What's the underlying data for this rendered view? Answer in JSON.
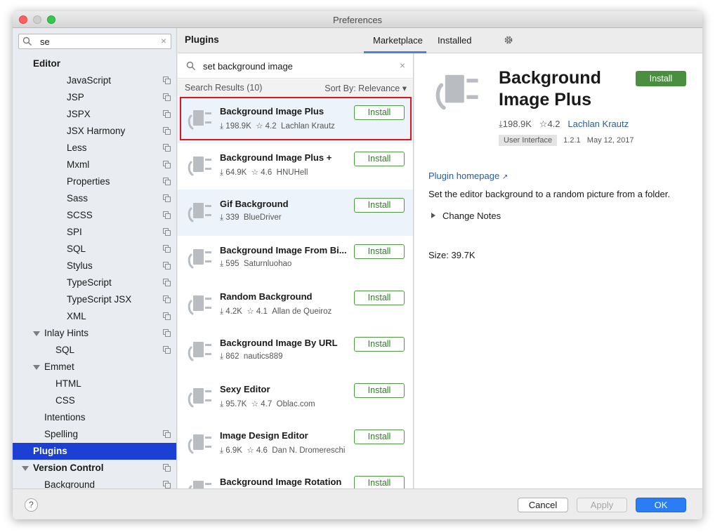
{
  "window": {
    "title": "Preferences"
  },
  "sidebar": {
    "search": {
      "value": "se"
    },
    "items": [
      {
        "label": "Editor",
        "indent": 0,
        "bold": true,
        "expand": "none",
        "copy": false,
        "selected": false
      },
      {
        "label": "JavaScript",
        "indent": 3,
        "bold": false,
        "expand": "none",
        "copy": true,
        "selected": false
      },
      {
        "label": "JSP",
        "indent": 3,
        "bold": false,
        "expand": "none",
        "copy": true,
        "selected": false
      },
      {
        "label": "JSPX",
        "indent": 3,
        "bold": false,
        "expand": "none",
        "copy": true,
        "selected": false
      },
      {
        "label": "JSX Harmony",
        "indent": 3,
        "bold": false,
        "expand": "none",
        "copy": true,
        "selected": false
      },
      {
        "label": "Less",
        "indent": 3,
        "bold": false,
        "expand": "none",
        "copy": true,
        "selected": false
      },
      {
        "label": "Mxml",
        "indent": 3,
        "bold": false,
        "expand": "none",
        "copy": true,
        "selected": false
      },
      {
        "label": "Properties",
        "indent": 3,
        "bold": false,
        "expand": "none",
        "copy": true,
        "selected": false
      },
      {
        "label": "Sass",
        "indent": 3,
        "bold": false,
        "expand": "none",
        "copy": true,
        "selected": false
      },
      {
        "label": "SCSS",
        "indent": 3,
        "bold": false,
        "expand": "none",
        "copy": true,
        "selected": false
      },
      {
        "label": "SPI",
        "indent": 3,
        "bold": false,
        "expand": "none",
        "copy": true,
        "selected": false
      },
      {
        "label": "SQL",
        "indent": 3,
        "bold": false,
        "expand": "none",
        "copy": true,
        "selected": false
      },
      {
        "label": "Stylus",
        "indent": 3,
        "bold": false,
        "expand": "none",
        "copy": true,
        "selected": false
      },
      {
        "label": "TypeScript",
        "indent": 3,
        "bold": false,
        "expand": "none",
        "copy": true,
        "selected": false
      },
      {
        "label": "TypeScript JSX",
        "indent": 3,
        "bold": false,
        "expand": "none",
        "copy": true,
        "selected": false
      },
      {
        "label": "XML",
        "indent": 3,
        "bold": false,
        "expand": "none",
        "copy": true,
        "selected": false
      },
      {
        "label": "Inlay Hints",
        "indent": 1,
        "bold": false,
        "expand": "open",
        "copy": true,
        "selected": false
      },
      {
        "label": "SQL",
        "indent": 2,
        "bold": false,
        "expand": "none",
        "copy": true,
        "selected": false
      },
      {
        "label": "Emmet",
        "indent": 1,
        "bold": false,
        "expand": "open",
        "copy": false,
        "selected": false
      },
      {
        "label": "HTML",
        "indent": 2,
        "bold": false,
        "expand": "none",
        "copy": false,
        "selected": false
      },
      {
        "label": "CSS",
        "indent": 2,
        "bold": false,
        "expand": "none",
        "copy": false,
        "selected": false
      },
      {
        "label": "Intentions",
        "indent": 1,
        "bold": false,
        "expand": "none",
        "copy": false,
        "selected": false
      },
      {
        "label": "Spelling",
        "indent": 1,
        "bold": false,
        "expand": "none",
        "copy": true,
        "selected": false
      },
      {
        "label": "Plugins",
        "indent": 0,
        "bold": true,
        "expand": "none",
        "copy": false,
        "selected": true
      },
      {
        "label": "Version Control",
        "indent": 0,
        "bold": true,
        "expand": "open",
        "copy": true,
        "selected": false
      },
      {
        "label": "Background",
        "indent": 1,
        "bold": false,
        "expand": "none",
        "copy": true,
        "selected": false
      }
    ]
  },
  "plugins_header": {
    "title": "Plugins",
    "tabs": [
      {
        "label": "Marketplace",
        "active": true
      },
      {
        "label": "Installed",
        "active": false
      }
    ],
    "settings_icon": "gear-icon"
  },
  "list": {
    "search": {
      "value": "set background image"
    },
    "results_label": "Search Results (10)",
    "sort_label": "Sort By: Relevance",
    "install_label": "Install",
    "plugins": [
      {
        "name": "Background Image Plus",
        "downloads": "198.9K",
        "rating": "4.2",
        "author": "Lachlan Krautz",
        "highlighted": true,
        "alt": true
      },
      {
        "name": "Background Image Plus +",
        "downloads": "64.9K",
        "rating": "4.6",
        "author": "HNUHell",
        "highlighted": false,
        "alt": false
      },
      {
        "name": "Gif Background",
        "downloads": "339",
        "rating": "",
        "author": "BlueDriver",
        "highlighted": false,
        "alt": true
      },
      {
        "name": "Background Image From Bi...",
        "downloads": "595",
        "rating": "",
        "author": "Saturnluohao",
        "highlighted": false,
        "alt": false
      },
      {
        "name": "Random Background",
        "downloads": "4.2K",
        "rating": "4.1",
        "author": "Allan de Queiroz",
        "highlighted": false,
        "alt": false
      },
      {
        "name": "Background Image By URL",
        "downloads": "862",
        "rating": "",
        "author": "nautics889",
        "highlighted": false,
        "alt": false
      },
      {
        "name": "Sexy Editor",
        "downloads": "95.7K",
        "rating": "4.7",
        "author": "Oblac.com",
        "highlighted": false,
        "alt": false
      },
      {
        "name": "Image Design Editor",
        "downloads": "6.9K",
        "rating": "4.6",
        "author": "Dan N. Dromereschi",
        "highlighted": false,
        "alt": false
      },
      {
        "name": "Background Image Rotation",
        "downloads": "",
        "rating": "",
        "author": "",
        "highlighted": false,
        "alt": false
      }
    ]
  },
  "detail": {
    "title": "Background Image Plus",
    "install_label": "Install",
    "downloads": "198.9K",
    "rating": "4.2",
    "author": "Lachlan Krautz",
    "tag": "User Interface",
    "version": "1.2.1",
    "date": "May 12, 2017",
    "homepage_label": "Plugin homepage",
    "description": "Set the editor background to a random picture from a folder.",
    "change_notes_label": "Change Notes",
    "size_label": "Size: 39.7K"
  },
  "footer": {
    "help_label": "?",
    "cancel_label": "Cancel",
    "apply_label": "Apply",
    "ok_label": "OK"
  },
  "colors": {
    "selection": "#1c3fd4",
    "install_green": "#4a8f3f",
    "ok_blue": "#2a7df5",
    "link_blue": "#2b5b9e",
    "highlight_red": "#e0141d"
  }
}
